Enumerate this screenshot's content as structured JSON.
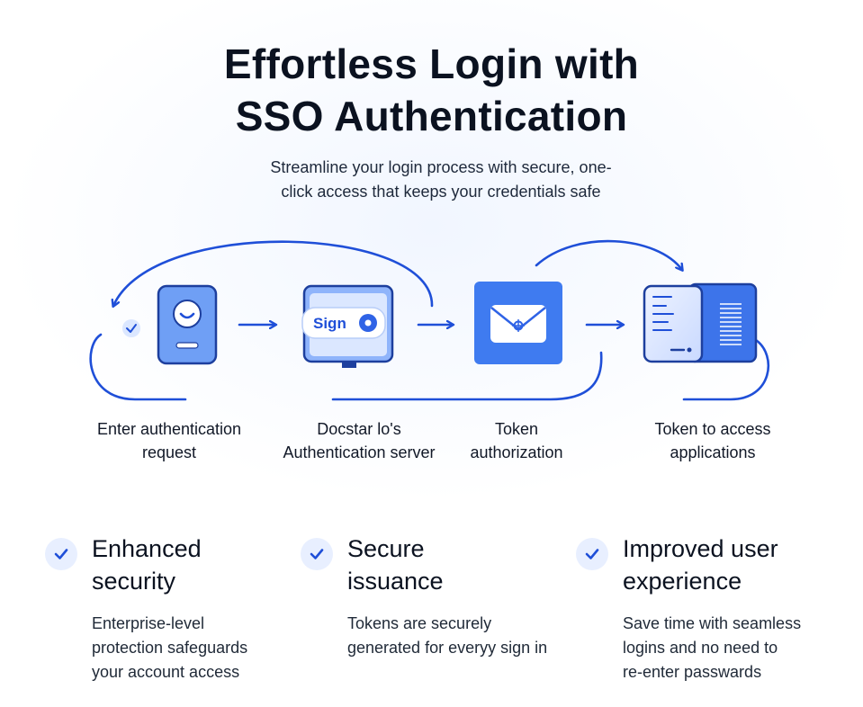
{
  "header": {
    "title_lines": [
      "Effortless Login with",
      "SSO Authentication"
    ],
    "subtitle_lines": [
      "Streamline your login process with secure, one-",
      "click access that keeps your credentials safe"
    ]
  },
  "flow": {
    "steps": [
      {
        "icon": "user-device-icon",
        "label_lines": [
          "Enter authentication",
          "request"
        ]
      },
      {
        "icon": "sign-in-monitor-icon",
        "label_lines": [
          "Docstar lo's",
          "Authentication server"
        ]
      },
      {
        "icon": "envelope-token-icon",
        "label_lines": [
          "Token",
          "authorization"
        ]
      },
      {
        "icon": "application-document-icon",
        "label_lines": [
          "Token to access",
          "applications"
        ]
      }
    ],
    "sign_label": "Sign",
    "colors": {
      "accent": "#1f4fd8",
      "icon_fill": "#5b8def",
      "icon_light": "#dbe7ff",
      "envelope_bg": "#3f7bf0"
    }
  },
  "features": [
    {
      "icon": "check-icon",
      "title_lines": [
        "Enhanced",
        "security"
      ],
      "desc_lines": [
        "Enterprise-level",
        "protection safeguards",
        "your account access"
      ]
    },
    {
      "icon": "check-icon",
      "title_lines": [
        "Secure",
        "issuance"
      ],
      "desc_lines": [
        "Tokens are securely",
        "generated for everyy sign in"
      ]
    },
    {
      "icon": "check-icon",
      "title_lines": [
        "Improved user",
        "experience"
      ],
      "desc_lines": [
        "Save time with seamless",
        "logins and no need to",
        "re-enter passwards"
      ]
    }
  ]
}
